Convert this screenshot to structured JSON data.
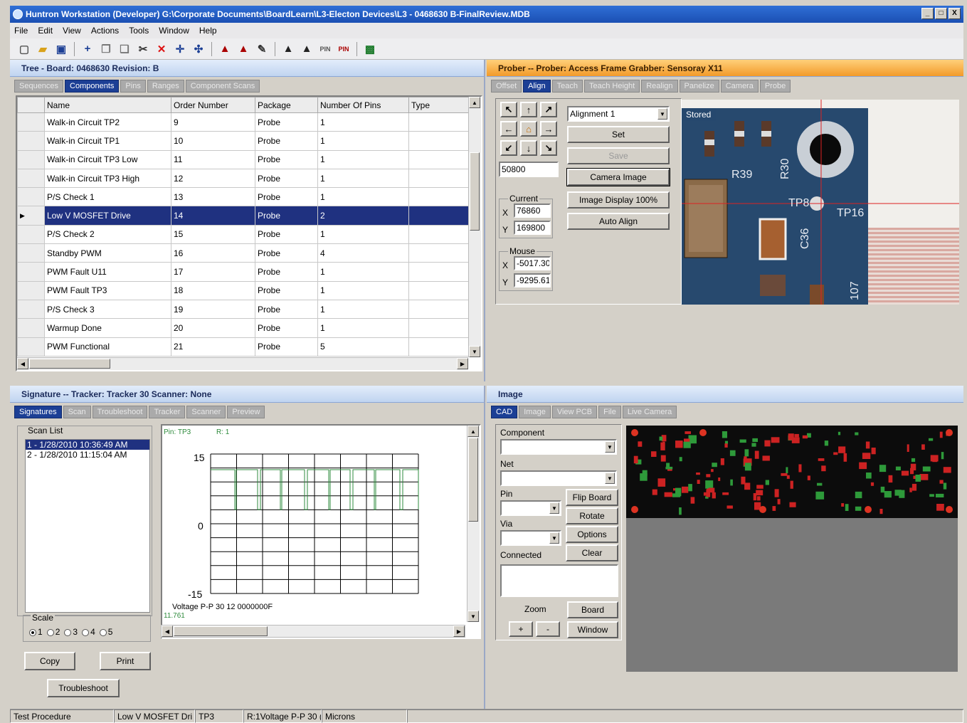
{
  "window": {
    "title": "Huntron Workstation (Developer) G:\\Corporate Documents\\BoardLearn\\L3-Electon Devices\\L3 - 0468630 B-FinalReview.MDB",
    "minimize": "_",
    "maximize": "□",
    "close": "X"
  },
  "menu": [
    "File",
    "Edit",
    "View",
    "Actions",
    "Tools",
    "Window",
    "Help"
  ],
  "tree_panel": {
    "title": "Tree - Board: 0468630   Revision: B",
    "tabs": [
      "Sequences",
      "Components",
      "Pins",
      "Ranges",
      "Component Scans"
    ],
    "active_tab": "Components",
    "columns": [
      "Name",
      "Order Number",
      "Package",
      "Number Of Pins",
      "Type"
    ],
    "rows": [
      [
        "Walk-in Circuit TP2",
        "9",
        "Probe",
        "1",
        ""
      ],
      [
        "Walk-in Circuit TP1",
        "10",
        "Probe",
        "1",
        ""
      ],
      [
        "Walk-in Circuit TP3 Low",
        "11",
        "Probe",
        "1",
        ""
      ],
      [
        "Walk-in Circuit TP3 High",
        "12",
        "Probe",
        "1",
        ""
      ],
      [
        "P/S Check 1",
        "13",
        "Probe",
        "1",
        ""
      ],
      [
        "Low V MOSFET Drive",
        "14",
        "Probe",
        "2",
        ""
      ],
      [
        "P/S Check 2",
        "15",
        "Probe",
        "1",
        ""
      ],
      [
        "Standby PWM",
        "16",
        "Probe",
        "4",
        ""
      ],
      [
        "PWM Fault U11",
        "17",
        "Probe",
        "1",
        ""
      ],
      [
        "PWM Fault TP3",
        "18",
        "Probe",
        "1",
        ""
      ],
      [
        "P/S Check 3",
        "19",
        "Probe",
        "1",
        ""
      ],
      [
        "Warmup Done",
        "20",
        "Probe",
        "1",
        ""
      ],
      [
        "PWM Functional",
        "21",
        "Probe",
        "5",
        ""
      ]
    ],
    "selected_row_index": 5
  },
  "prober_panel": {
    "title": "Prober -- Prober: Access Frame Grabber: Sensoray X11",
    "tabs": [
      "Offset",
      "Align",
      "Teach",
      "Teach Height",
      "Realign",
      "Panelize",
      "Camera",
      "Probe"
    ],
    "active_tab": "Align",
    "step_value": "50800",
    "alignment_select": "Alignment 1",
    "buttons": [
      "Set",
      "Save",
      "Camera Image",
      "Image Display 100%",
      "Auto Align"
    ],
    "current_label": "Current",
    "current_x": "76860",
    "current_y": "169800",
    "mouse_label": "Mouse",
    "mouse_x": "-5017.30",
    "mouse_y": "-9295.61",
    "x_label": "X",
    "y_label": "Y",
    "image_tag": "Stored",
    "board_labels": [
      "R39",
      "R30",
      "TP8",
      "TP16",
      "C36",
      "107"
    ]
  },
  "signature_panel": {
    "title": "Signature -- Tracker: Tracker 30   Scanner: None",
    "tabs": [
      "Signatures",
      "Scan",
      "Troubleshoot",
      "Tracker",
      "Scanner",
      "Preview"
    ],
    "active_tab": "Signatures",
    "scan_list_label": "Scan List",
    "scan_list": [
      "1 - 1/28/2010 10:36:49 AM",
      "2 - 1/28/2010 11:15:04 AM"
    ],
    "scale_label": "Scale",
    "scale_options": [
      "1",
      "2",
      "3",
      "4",
      "5"
    ],
    "scale_selected": "1",
    "buttons": {
      "copy": "Copy",
      "print": "Print",
      "troubleshoot": "Troubleshoot"
    },
    "plot": {
      "pin_label": "Pin: TP3",
      "r_label": "R: 1",
      "y_top": "15",
      "y_mid": "0",
      "y_bottom": "-15",
      "footer": "Voltage P-P  30  12  0000000F",
      "reading": "11.761"
    }
  },
  "image_panel": {
    "title": "Image",
    "tabs": [
      "CAD",
      "Image",
      "View PCB",
      "File",
      "Live Camera"
    ],
    "active_tab": "CAD",
    "labels": {
      "component": "Component",
      "net": "Net",
      "pin": "Pin",
      "via": "Via",
      "connected": "Connected",
      "zoom": "Zoom"
    },
    "buttons": {
      "flip": "Flip Board",
      "rotate": "Rotate",
      "options": "Options",
      "clear": "Clear",
      "board": "Board",
      "window": "Window",
      "zoom_in": "+",
      "zoom_out": "-"
    }
  },
  "status_bar": [
    "Test Procedure",
    "Low V MOSFET Dri",
    "TP3",
    "R:1Voltage P-P 30 (",
    "Microns"
  ],
  "colors": {
    "selection": "#1f3180",
    "trace": "#2e8b3c",
    "pcb_bg": "#0c0c0c",
    "pcb_copper": "#cc2222"
  }
}
